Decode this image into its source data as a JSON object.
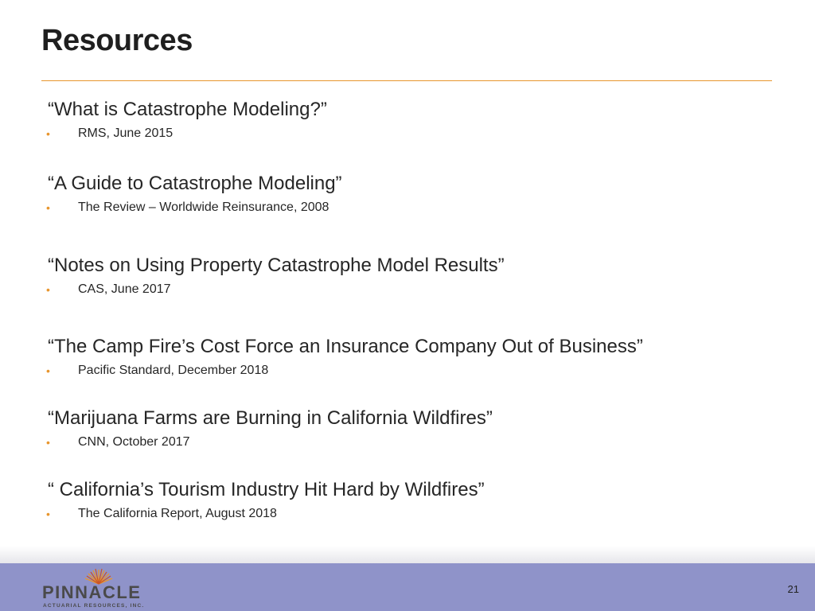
{
  "slide": {
    "title": "Resources",
    "page_number": "21",
    "accent_color": "#e8962e",
    "footer_color": "#8f93c9"
  },
  "resources": [
    {
      "title": "“What is Catastrophe Modeling?”",
      "source": "RMS, June 2015"
    },
    {
      "title": "“A Guide to Catastrophe Modeling”",
      "source": "The Review – Worldwide Reinsurance, 2008"
    },
    {
      "title": "“Notes on Using Property Catastrophe Model Results”",
      "source": "CAS, June 2017"
    },
    {
      "title": "“The Camp Fire’s Cost Force an Insurance Company Out of Business”",
      "source": "Pacific Standard, December 2018"
    },
    {
      "title": "“Marijuana Farms are Burning in California Wildfires”",
      "source": "CNN, October 2017"
    },
    {
      "title": "“ California’s Tourism Industry Hit Hard by Wildfires”",
      "source": "The California Report, August 2018"
    }
  ],
  "bullet_glyph": "•",
  "logo": {
    "name": "PINNACLE",
    "tagline": "ACTUARIAL RESOURCES, INC.",
    "icon": "sunburst-icon"
  }
}
